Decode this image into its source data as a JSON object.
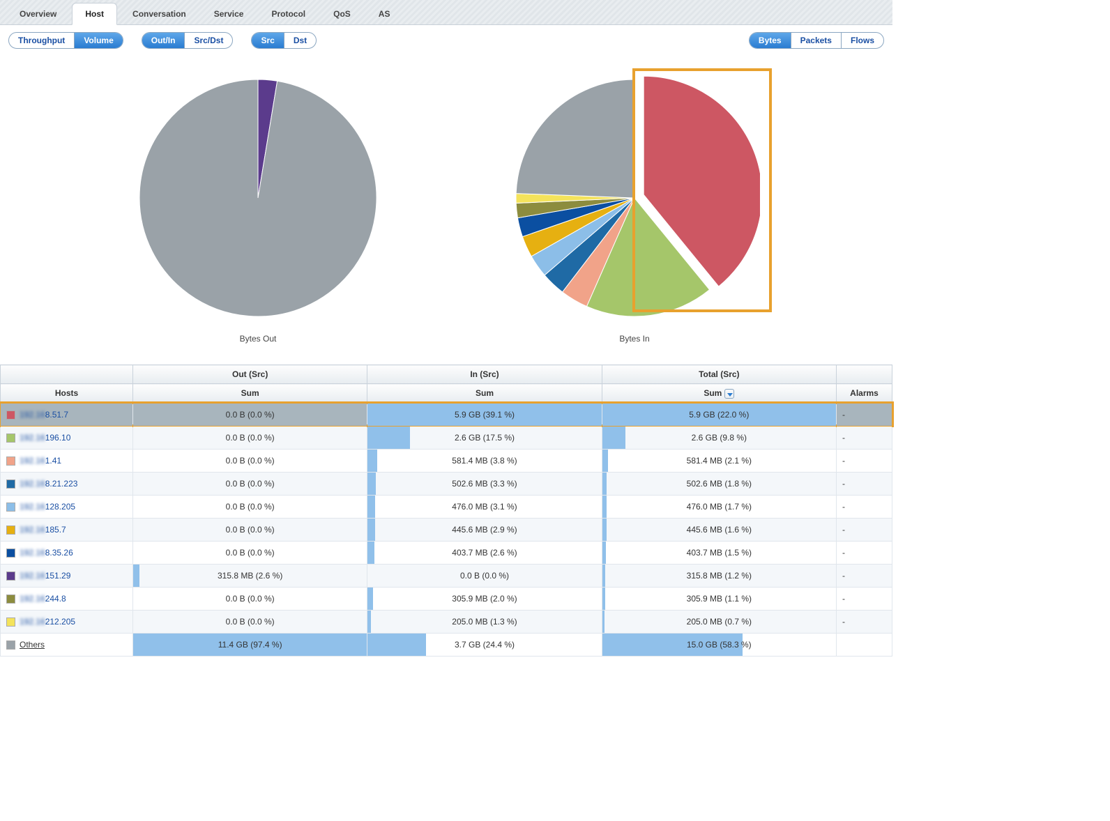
{
  "tabs": [
    "Overview",
    "Host",
    "Conversation",
    "Service",
    "Protocol",
    "QoS",
    "AS"
  ],
  "active_tab": 1,
  "segmented": {
    "g1": {
      "items": [
        "Throughput",
        "Volume"
      ],
      "active": 1
    },
    "g2": {
      "items": [
        "Out/In",
        "Src/Dst"
      ],
      "active": 0
    },
    "g3": {
      "items": [
        "Src",
        "Dst"
      ],
      "active": 0
    },
    "g4": {
      "items": [
        "Bytes",
        "Packets",
        "Flows"
      ],
      "active": 0
    }
  },
  "chart_data": [
    {
      "type": "pie",
      "title": "Bytes Out",
      "series": [
        {
          "name": "151.29",
          "value": 2.6,
          "color": "#5b3b8c"
        },
        {
          "name": "Others",
          "value": 97.4,
          "color": "#9aa2a8"
        }
      ]
    },
    {
      "type": "pie",
      "title": "Bytes In",
      "series": [
        {
          "name": "8.51.7",
          "value": 39.1,
          "color": "#cd5763"
        },
        {
          "name": "196.10",
          "value": 17.5,
          "color": "#a5c66a"
        },
        {
          "name": "1.41",
          "value": 3.8,
          "color": "#f1a389"
        },
        {
          "name": "8.21.223",
          "value": 3.3,
          "color": "#1f6aa5"
        },
        {
          "name": "128.205",
          "value": 3.1,
          "color": "#8cbee8"
        },
        {
          "name": "185.7",
          "value": 2.9,
          "color": "#e6b011"
        },
        {
          "name": "8.35.26",
          "value": 2.6,
          "color": "#0b4fa1"
        },
        {
          "name": "244.8",
          "value": 2.0,
          "color": "#8c8c3e"
        },
        {
          "name": "212.205",
          "value": 1.3,
          "color": "#f4e35b"
        },
        {
          "name": "Others",
          "value": 24.4,
          "color": "#9aa2a8"
        }
      ]
    }
  ],
  "table": {
    "headers": {
      "group": [
        "",
        "Out (Src)",
        "In (Src)",
        "Total (Src)",
        ""
      ],
      "sub": [
        "Hosts",
        "Sum",
        "Sum",
        "Sum",
        "Alarms"
      ]
    },
    "rows": [
      {
        "color": "#cd5763",
        "host_blur": "1",
        "host": "8.51.7",
        "out": "0.0 B (0.0 %)",
        "out_pct": 0,
        "in": "5.9 GB (39.1 %)",
        "in_pct": 100,
        "total": "5.9 GB (22.0 %)",
        "total_pct": 100,
        "alarms": "-",
        "hl": true
      },
      {
        "color": "#a5c66a",
        "host_blur": "1",
        "host": "196.10",
        "out": "0.0 B (0.0 %)",
        "out_pct": 0,
        "in": "2.6 GB (17.5 %)",
        "in_pct": 18,
        "total": "2.6 GB (9.8 %)",
        "total_pct": 10,
        "alarms": "-"
      },
      {
        "color": "#f1a389",
        "host_blur": "1",
        "host": "1.41",
        "out": "0.0 B (0.0 %)",
        "out_pct": 0,
        "in": "581.4 MB (3.8 %)",
        "in_pct": 4,
        "total": "581.4 MB (2.1 %)",
        "total_pct": 2.5,
        "alarms": "-"
      },
      {
        "color": "#1f6aa5",
        "host_blur": "1",
        "host": "8.21.223",
        "out": "0.0 B (0.0 %)",
        "out_pct": 0,
        "in": "502.6 MB (3.3 %)",
        "in_pct": 3.5,
        "total": "502.6 MB (1.8 %)",
        "total_pct": 2,
        "alarms": "-"
      },
      {
        "color": "#8cbee8",
        "host_blur": "1",
        "host": "128.205",
        "out": "0.0 B (0.0 %)",
        "out_pct": 0,
        "in": "476.0 MB (3.1 %)",
        "in_pct": 3.3,
        "total": "476.0 MB (1.7 %)",
        "total_pct": 1.9,
        "alarms": "-"
      },
      {
        "color": "#e6b011",
        "host_blur": "1",
        "host": "185.7",
        "out": "0.0 B (0.0 %)",
        "out_pct": 0,
        "in": "445.6 MB (2.9 %)",
        "in_pct": 3.1,
        "total": "445.6 MB (1.6 %)",
        "total_pct": 1.8,
        "alarms": "-"
      },
      {
        "color": "#0b4fa1",
        "host_blur": "1",
        "host": "8.35.26",
        "out": "0.0 B (0.0 %)",
        "out_pct": 0,
        "in": "403.7 MB (2.6 %)",
        "in_pct": 2.8,
        "total": "403.7 MB (1.5 %)",
        "total_pct": 1.7,
        "alarms": "-"
      },
      {
        "color": "#5b3b8c",
        "host_blur": "1",
        "host": "151.29",
        "out": "315.8 MB (2.6 %)",
        "out_pct": 2.7,
        "in": "0.0 B (0.0 %)",
        "in_pct": 0,
        "total": "315.8 MB (1.2 %)",
        "total_pct": 1.4,
        "alarms": "-"
      },
      {
        "color": "#8c8c3e",
        "host_blur": "1",
        "host": "244.8",
        "out": "0.0 B (0.0 %)",
        "out_pct": 0,
        "in": "305.9 MB (2.0 %)",
        "in_pct": 2.2,
        "total": "305.9 MB (1.1 %)",
        "total_pct": 1.3,
        "alarms": "-"
      },
      {
        "color": "#f4e35b",
        "host_blur": "1",
        "host": "212.205",
        "out": "0.0 B (0.0 %)",
        "out_pct": 0,
        "in": "205.0 MB (1.3 %)",
        "in_pct": 1.5,
        "total": "205.0 MB (0.7 %)",
        "total_pct": 0.9,
        "alarms": "-"
      },
      {
        "color": "#9aa2a8",
        "host_blur": "",
        "host": "Others",
        "out": "11.4 GB (97.4 %)",
        "out_pct": 100,
        "in": "3.7 GB (24.4 %)",
        "in_pct": 25,
        "total": "15.0 GB (58.3 %)",
        "total_pct": 60,
        "alarms": "",
        "others": true
      }
    ]
  }
}
